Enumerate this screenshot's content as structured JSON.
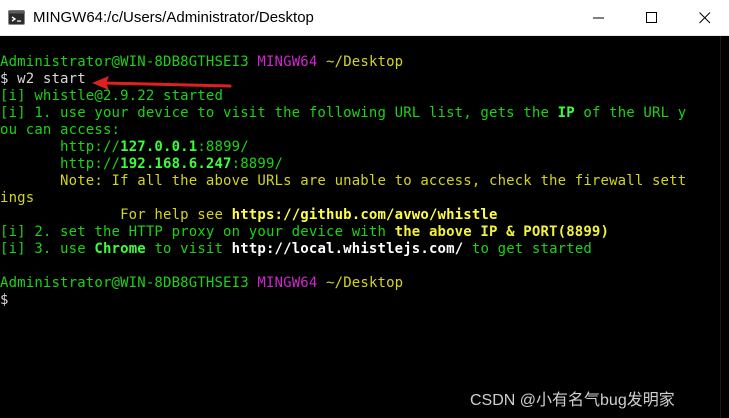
{
  "window": {
    "title": "MINGW64:/c/Users/Administrator/Desktop",
    "icon": "git-bash-icon",
    "controls": [
      "minimize-icon",
      "maximize-icon",
      "close-icon"
    ]
  },
  "terminal": {
    "prompt1": {
      "user": "Administrator@WIN-8DB8GTHSEI3",
      "env": "MINGW64",
      "path": "~/Desktop"
    },
    "command": "$ w2 start",
    "out1": "[i] whistle@2.9.22 started",
    "out2a": "[i] 1. use your device to visit the following URL list, gets the ",
    "out2b": "IP",
    "out2c": " of the URL y",
    "out3": "ou can access:",
    "url1_prefix": "       http://",
    "url1_ip": "127.0.0.1",
    "url1_port": ":8899/",
    "url2_prefix": "       http://",
    "url2_ip": "192.168.6.247",
    "url2_port": ":8899/",
    "note1": "       Note: If all the above URLs are unable to access, check the firewall sett",
    "note2": "ings",
    "help_prefix": "              For help see ",
    "help_link": "https://github.com/avwo/whistle",
    "step2_a": "[i] 2. set the HTTP proxy on your device with ",
    "step2_b": "the above IP & PORT(8899)",
    "step3_a": "[i] 3. use ",
    "step3_b": "Chrome",
    "step3_c": " to visit ",
    "step3_d": "http://local.whistlejs.com/",
    "step3_e": " to get started",
    "prompt2": {
      "user": "Administrator@WIN-8DB8GTHSEI3",
      "env": "MINGW64",
      "path": "~/Desktop"
    },
    "cursor_line": "$",
    "colors": {
      "green": "#1cd315",
      "magenta": "#cf27cf",
      "yellow": "#d4d41e",
      "arrow": "#e0201e"
    }
  },
  "watermark": "CSDN @小有名气bug发明家"
}
